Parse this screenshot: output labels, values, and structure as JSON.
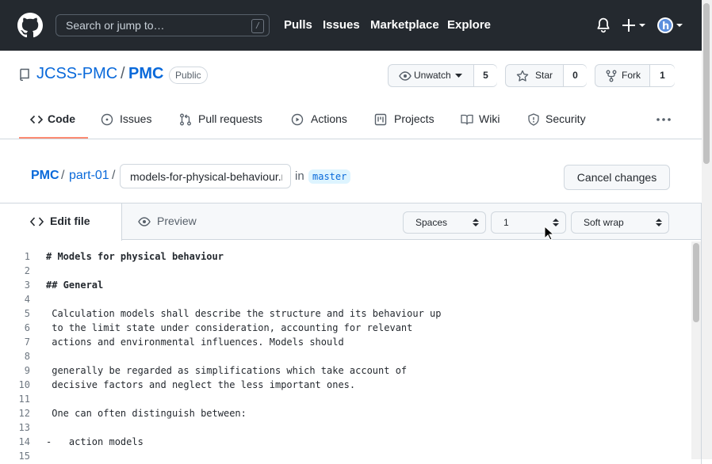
{
  "header": {
    "search_placeholder": "Search or jump to…",
    "search_shortcut": "/",
    "nav": [
      "Pulls",
      "Issues",
      "Marketplace",
      "Explore"
    ],
    "icons": [
      "github-logo-icon",
      "bell-icon",
      "plus-icon",
      "avatar"
    ]
  },
  "repo": {
    "owner": "JCSS-PMC",
    "separator": "/",
    "name": "PMC",
    "visibility": "Public",
    "watch_label": "Unwatch",
    "watch_count": "5",
    "star_label": "Star",
    "star_count": "0",
    "fork_label": "Fork",
    "fork_count": "1"
  },
  "tabs": [
    "Code",
    "Issues",
    "Pull requests",
    "Actions",
    "Projects",
    "Wiki",
    "Security"
  ],
  "breadcrumb": {
    "root": "PMC",
    "folder": "part-01",
    "sep": "/",
    "filename": "models-for-physical-behaviour.md",
    "in": "in",
    "branch": "master"
  },
  "cancel_label": "Cancel changes",
  "editor": {
    "edit_tab": "Edit file",
    "preview_tab": "Preview",
    "indent_mode": "Spaces",
    "indent_size": "1",
    "wrap_mode": "Soft wrap",
    "lines": [
      {
        "n": "1",
        "t": "# Models for physical behaviour"
      },
      {
        "n": "2",
        "t": ""
      },
      {
        "n": "3",
        "t": "## General"
      },
      {
        "n": "4",
        "t": ""
      },
      {
        "n": "5",
        "t": " Calculation models shall describe the structure and its behaviour up"
      },
      {
        "n": "6",
        "t": " to the limit state under consideration, accounting for relevant"
      },
      {
        "n": "7",
        "t": " actions and environmental influences. Models should"
      },
      {
        "n": "8",
        "t": ""
      },
      {
        "n": "9",
        "t": " generally be regarded as simplifications which take account of"
      },
      {
        "n": "10",
        "t": " decisive factors and neglect the less important ones."
      },
      {
        "n": "11",
        "t": ""
      },
      {
        "n": "12",
        "t": " One can often distinguish between:"
      },
      {
        "n": "13",
        "t": ""
      },
      {
        "n": "14",
        "t": "-   action models"
      },
      {
        "n": "15",
        "t": ""
      }
    ]
  },
  "colors": {
    "header_bg": "#24292f",
    "link": "#0969da",
    "tab_underline": "#fd8c73"
  }
}
